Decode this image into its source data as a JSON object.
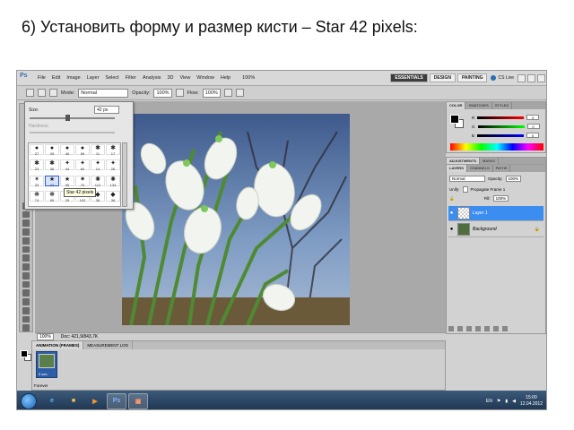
{
  "slide": {
    "title": "6) Установить форму и размер кисти – Star 42 pixels:"
  },
  "photoshop": {
    "app_logo": "Ps",
    "menu": [
      "File",
      "Edit",
      "Image",
      "Layer",
      "Select",
      "Filter",
      "Analysis",
      "3D",
      "View",
      "Window",
      "Help"
    ],
    "zoom_display": "100%",
    "workspaces": [
      "ESSENTIALS",
      "DESIGN",
      "PAINTING"
    ],
    "active_workspace": "ESSENTIALS",
    "cs_live": "CS Live",
    "options_bar": {
      "mode_label": "Mode:",
      "mode_value": "Normal",
      "opacity_label": "Opacity:",
      "opacity_value": "100%",
      "flow_label": "Flow:",
      "flow_value": "100%"
    },
    "brush_picker": {
      "size_label": "Size:",
      "size_value": "42 px",
      "hardness_label": "Hardness:",
      "tooltip": "Star 42 pixels",
      "brush_sizes": [
        "27",
        "39",
        "46",
        "59",
        "11",
        "17",
        "23",
        "36",
        "44",
        "60",
        "14",
        "26",
        "33",
        "42",
        "55",
        "70",
        "112",
        "134",
        "74",
        "95",
        "29",
        "192",
        "36",
        "36"
      ],
      "selected_index": 13
    },
    "document": {
      "tab_title": "Untitled-1 @ 100% (Layer 1, RGB/8)",
      "zoom": "100%",
      "doc_info": "Doc: 421,9/843,7K"
    },
    "animation_panel": {
      "tabs": [
        "ANIMATION (FRAMES)",
        "MEASUREMENT LOG"
      ],
      "frame_delay": "0 sec.",
      "loop": "Forever"
    },
    "color_panel": {
      "tabs": [
        "COLOR",
        "SWATCHES",
        "STYLES"
      ],
      "channels": [
        {
          "label": "R",
          "value": "0",
          "color": "#d33"
        },
        {
          "label": "G",
          "value": "0",
          "color": "#3a3"
        },
        {
          "label": "B",
          "value": "0",
          "color": "#33d"
        }
      ]
    },
    "adjustments_panel": {
      "tabs": [
        "ADJUSTMENTS",
        "MASKS"
      ]
    },
    "layers_panel": {
      "tabs": [
        "LAYERS",
        "CHANNELS",
        "PATHS"
      ],
      "blend_mode": "Normal",
      "opacity_label": "Opacity:",
      "opacity_value": "100%",
      "lock_label": "Unify:",
      "propagate_label": "Propagate Frame 1",
      "fill_label": "Fill:",
      "fill_value": "100%",
      "layers": [
        {
          "name": "Layer 1",
          "selected": true,
          "thumb": "transparent"
        },
        {
          "name": "Background",
          "selected": false,
          "thumb": "photo"
        }
      ]
    },
    "taskbar": {
      "lang": "EN",
      "time": "15:00",
      "date": "12.04.2012"
    }
  }
}
